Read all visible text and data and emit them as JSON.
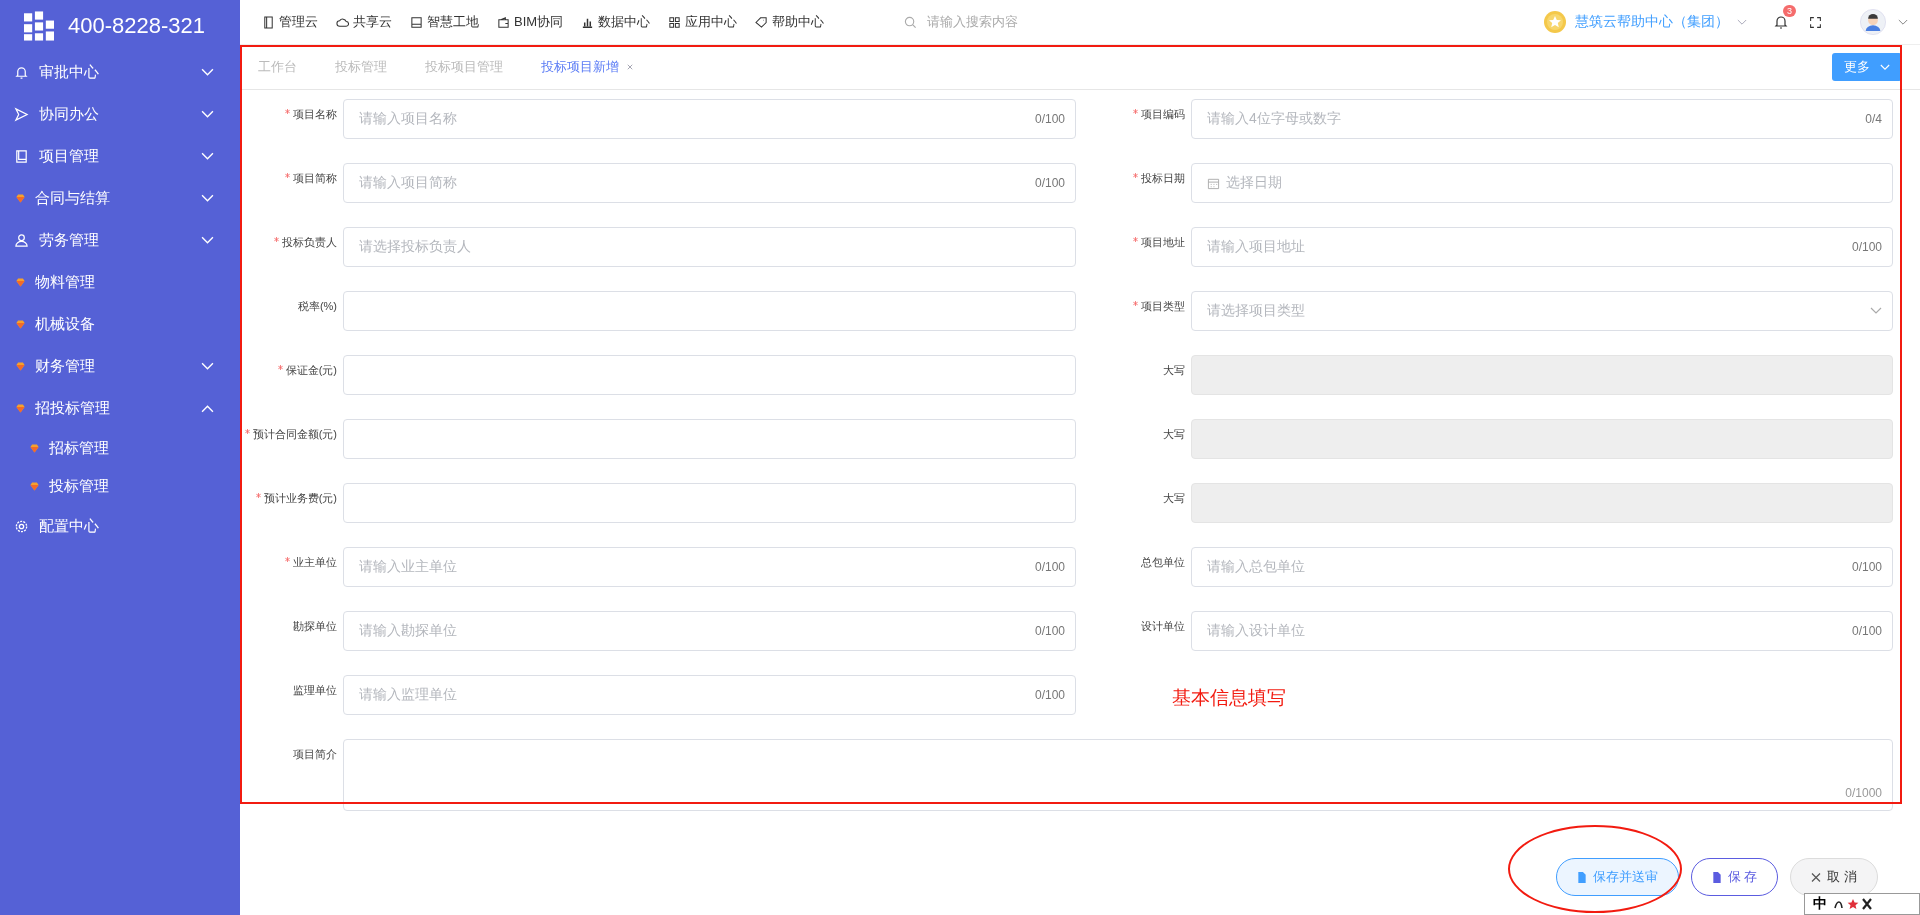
{
  "logo": {
    "phone": "400-8228-321"
  },
  "sidebar": {
    "items": [
      {
        "label": "审批中心",
        "kind": "bell",
        "expanded": false
      },
      {
        "label": "协同办公",
        "kind": "send",
        "expanded": false
      },
      {
        "label": "项目管理",
        "kind": "book",
        "expanded": false
      },
      {
        "label": "合同与结算",
        "kind": "gem",
        "expanded": false
      },
      {
        "label": "劳务管理",
        "kind": "user",
        "expanded": false
      },
      {
        "label": "物料管理",
        "kind": "gem"
      },
      {
        "label": "机械设备",
        "kind": "gem"
      },
      {
        "label": "财务管理",
        "kind": "gem",
        "expanded": false
      },
      {
        "label": "招投标管理",
        "kind": "gem",
        "expanded": true,
        "children": [
          {
            "label": "招标管理"
          },
          {
            "label": "投标管理"
          }
        ]
      },
      {
        "label": "配置中心",
        "kind": "gear"
      }
    ]
  },
  "top_nav": [
    {
      "label": "管理云",
      "kind": "card"
    },
    {
      "label": "共享云",
      "kind": "cloud"
    },
    {
      "label": "智慧工地",
      "kind": "book"
    },
    {
      "label": "BIM协同",
      "kind": "wallet"
    },
    {
      "label": "数据中心",
      "kind": "chart"
    },
    {
      "label": "应用中心",
      "kind": "grid"
    },
    {
      "label": "帮助中心",
      "kind": "tag"
    }
  ],
  "search": {
    "placeholder": "请输入搜索内容"
  },
  "org": {
    "name": "慧筑云帮助中心（集团）"
  },
  "notifications": {
    "count": "3"
  },
  "tabs": [
    {
      "label": "工作台",
      "selected": false
    },
    {
      "label": "投标管理",
      "selected": false
    },
    {
      "label": "投标项目管理",
      "selected": false
    },
    {
      "label": "投标项目新增",
      "selected": true,
      "closable": true
    }
  ],
  "more_button": "更多",
  "form": {
    "rows": [
      [
        {
          "label": "项目名称",
          "required": true,
          "kind": "text",
          "placeholder": "请输入项目名称",
          "counter": "0/100"
        },
        {
          "label": "项目编码",
          "required": true,
          "kind": "text",
          "placeholder": "请输入4位字母或数字",
          "counter": "0/4"
        }
      ],
      [
        {
          "label": "项目简称",
          "required": true,
          "kind": "text",
          "placeholder": "请输入项目简称",
          "counter": "0/100"
        },
        {
          "label": "投标日期",
          "required": true,
          "kind": "date",
          "placeholder": "选择日期"
        }
      ],
      [
        {
          "label": "投标负责人",
          "required": true,
          "kind": "text",
          "placeholder": "请选择投标负责人"
        },
        {
          "label": "项目地址",
          "required": true,
          "kind": "text",
          "placeholder": "请输入项目地址",
          "counter": "0/100"
        }
      ],
      [
        {
          "label": "税率(%)",
          "required": false,
          "kind": "text"
        },
        {
          "label": "项目类型",
          "required": true,
          "kind": "select",
          "placeholder": "请选择项目类型"
        }
      ],
      [
        {
          "label": "保证金(元)",
          "required": true,
          "kind": "text"
        },
        {
          "label": "大写",
          "required": false,
          "kind": "disabled"
        }
      ],
      [
        {
          "label": "预计合同金额(元)",
          "required": true,
          "kind": "text"
        },
        {
          "label": "大写",
          "required": false,
          "kind": "disabled"
        }
      ],
      [
        {
          "label": "预计业务费(元)",
          "required": true,
          "kind": "text"
        },
        {
          "label": "大写",
          "required": false,
          "kind": "disabled"
        }
      ],
      [
        {
          "label": "业主单位",
          "required": true,
          "kind": "text",
          "placeholder": "请输入业主单位",
          "counter": "0/100"
        },
        {
          "label": "总包单位",
          "required": false,
          "kind": "text",
          "placeholder": "请输入总包单位",
          "counter": "0/100"
        }
      ],
      [
        {
          "label": "勘探单位",
          "required": false,
          "kind": "text",
          "placeholder": "请输入勘探单位",
          "counter": "0/100"
        },
        {
          "label": "设计单位",
          "required": false,
          "kind": "text",
          "placeholder": "请输入设计单位",
          "counter": "0/100"
        }
      ],
      [
        {
          "label": "监理单位",
          "required": false,
          "kind": "text",
          "placeholder": "请输入监理单位",
          "counter": "0/100"
        },
        {
          "label": "基本信息填写",
          "kind": "note"
        }
      ]
    ],
    "textarea": {
      "label": "项目简介",
      "counter": "0/1000"
    }
  },
  "buttons": [
    {
      "label": "保存并送审",
      "kind": "outline"
    },
    {
      "label": "保 存",
      "kind": "outline-purple"
    },
    {
      "label": "取 消",
      "kind": "cancel"
    }
  ],
  "ime_bar": {
    "label": "中"
  }
}
